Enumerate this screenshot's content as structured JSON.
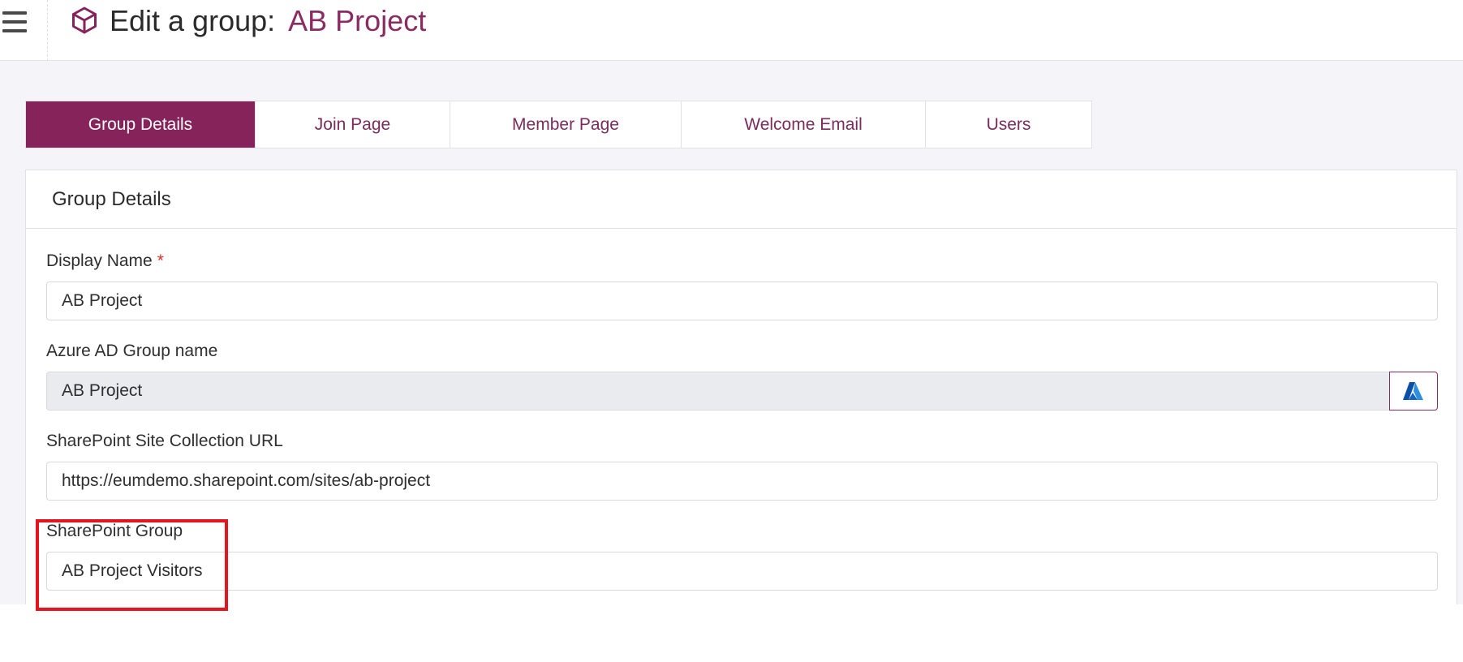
{
  "header": {
    "title_prefix": "Edit a group:",
    "group_name": "AB Project",
    "menu_icon": "hamburger-menu-icon",
    "title_icon": "cube-icon"
  },
  "tabs": [
    {
      "label": "Group Details",
      "active": true
    },
    {
      "label": "Join Page",
      "active": false
    },
    {
      "label": "Member Page",
      "active": false
    },
    {
      "label": "Welcome Email",
      "active": false
    },
    {
      "label": "Users",
      "active": false
    }
  ],
  "card": {
    "title": "Group Details",
    "fields": {
      "display_name": {
        "label": "Display Name",
        "required_marker": "*",
        "value": "AB Project"
      },
      "azure_ad_group": {
        "label": "Azure AD Group name",
        "value": "AB Project",
        "button_icon": "azure-logo-icon"
      },
      "sharepoint_url": {
        "label": "SharePoint Site Collection URL",
        "value": "https://eumdemo.sharepoint.com/sites/ab-project"
      },
      "sharepoint_group": {
        "label": "SharePoint Group",
        "value": "AB Project Visitors"
      }
    }
  },
  "colors": {
    "brand": "#86235a",
    "brand_text": "#8a2b61",
    "highlight": "#e3161f",
    "required": "#d93025"
  }
}
